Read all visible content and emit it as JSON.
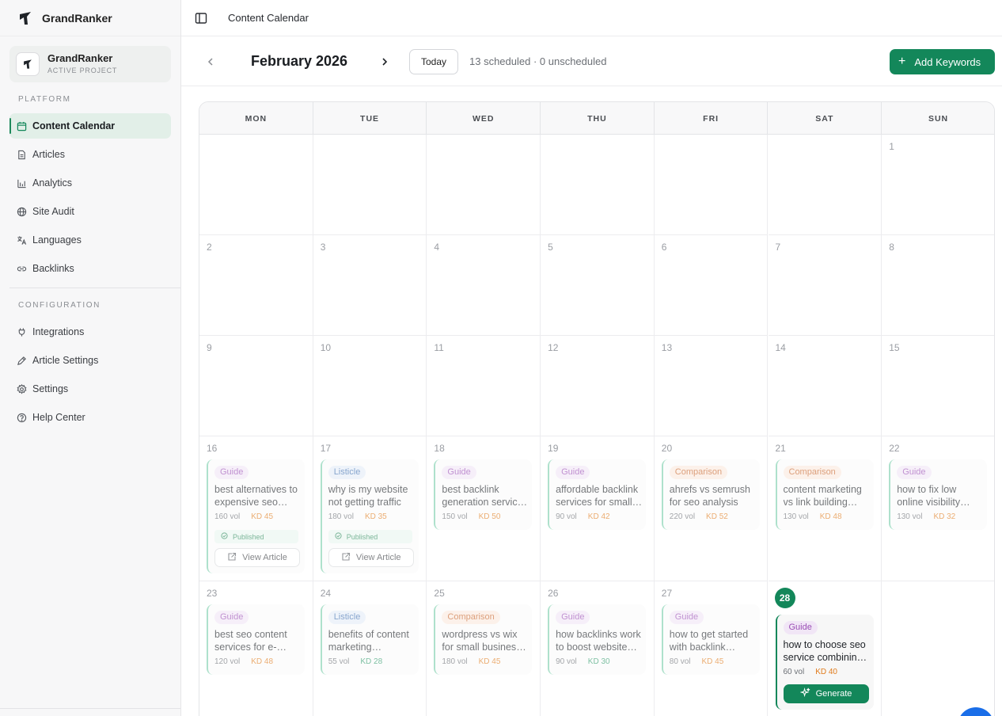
{
  "app": {
    "name": "GrandRanker"
  },
  "project": {
    "name": "GrandRanker",
    "status": "ACTIVE PROJECT"
  },
  "sidebar": {
    "platform_label": "PLATFORM",
    "platform_items": [
      {
        "label": "Content Calendar",
        "icon": "calendar-icon",
        "active": true
      },
      {
        "label": "Articles",
        "icon": "document-icon"
      },
      {
        "label": "Analytics",
        "icon": "bar-chart-icon"
      },
      {
        "label": "Site Audit",
        "icon": "globe-icon"
      },
      {
        "label": "Languages",
        "icon": "translate-icon"
      },
      {
        "label": "Backlinks",
        "icon": "link-icon"
      }
    ],
    "config_label": "CONFIGURATION",
    "config_items": [
      {
        "label": "Integrations",
        "icon": "plug-icon"
      },
      {
        "label": "Article Settings",
        "icon": "pen-icon"
      },
      {
        "label": "Settings",
        "icon": "gear-icon"
      },
      {
        "label": "Help Center",
        "icon": "help-circle-icon"
      }
    ]
  },
  "topbar": {
    "title": "Content Calendar"
  },
  "calendar": {
    "month_label": "February 2026",
    "today_label": "Today",
    "summary": "13 scheduled · 0 unscheduled",
    "add_label": "Add Keywords",
    "weekdays": [
      "MON",
      "TUE",
      "WED",
      "THU",
      "FRI",
      "SAT",
      "SUN"
    ],
    "weeks": [
      [
        null,
        null,
        null,
        null,
        null,
        null,
        1
      ],
      [
        2,
        3,
        4,
        5,
        6,
        7,
        8
      ],
      [
        9,
        10,
        11,
        12,
        13,
        14,
        15
      ],
      [
        16,
        17,
        18,
        19,
        20,
        21,
        22
      ],
      [
        23,
        24,
        25,
        26,
        27,
        28,
        null
      ]
    ],
    "today": 28,
    "published_label": "Published",
    "view_label": "View Article",
    "generate_label": "Generate",
    "entries": {
      "16": {
        "tag": "Guide",
        "title": [
          "best alternatives to",
          "expensive seo…"
        ],
        "vol": "160 vol",
        "kd": "KD 45",
        "published": true
      },
      "17": {
        "tag": "Listicle",
        "title": [
          "why is my website",
          "not getting traffic"
        ],
        "vol": "180 vol",
        "kd": "KD 35",
        "published": true
      },
      "18": {
        "tag": "Guide",
        "title": [
          "best backlink",
          "generation servic…"
        ],
        "vol": "150 vol",
        "kd": "KD 50"
      },
      "19": {
        "tag": "Guide",
        "title": [
          "affordable backlink",
          "services for small…"
        ],
        "vol": "90 vol",
        "kd": "KD 42"
      },
      "20": {
        "tag": "Comparison",
        "title": [
          "ahrefs vs semrush",
          "for seo analysis"
        ],
        "vol": "220 vol",
        "kd": "KD 52"
      },
      "21": {
        "tag": "Comparison",
        "title": [
          "content marketing",
          "vs link building…"
        ],
        "vol": "130 vol",
        "kd": "KD 48"
      },
      "22": {
        "tag": "Guide",
        "title": [
          "how to fix low",
          "online visibility…"
        ],
        "vol": "130 vol",
        "kd": "KD 32"
      },
      "23": {
        "tag": "Guide",
        "title": [
          "best seo content",
          "services for e-…"
        ],
        "vol": "120 vol",
        "kd": "KD 48"
      },
      "24": {
        "tag": "Listicle",
        "title": [
          "benefits of content",
          "marketing…"
        ],
        "vol": "55 vol",
        "kd": "KD 28",
        "kd_low": true
      },
      "25": {
        "tag": "Comparison",
        "title": [
          "wordpress vs wix",
          "for small business…"
        ],
        "vol": "180 vol",
        "kd": "KD 45"
      },
      "26": {
        "tag": "Guide",
        "title": [
          "how backlinks work",
          "to boost website…"
        ],
        "vol": "90 vol",
        "kd": "KD 30",
        "kd_low": true
      },
      "27": {
        "tag": "Guide",
        "title": [
          "how to get started",
          "with backlink…"
        ],
        "vol": "80 vol",
        "kd": "KD 45"
      },
      "28": {
        "tag": "Guide",
        "title": [
          "how to choose seo",
          "service combinin…"
        ],
        "vol": "60 vol",
        "kd": "KD 40",
        "generate": true
      }
    }
  },
  "colors": {
    "accent": "#13875a",
    "fab": "#1a6ee8"
  }
}
